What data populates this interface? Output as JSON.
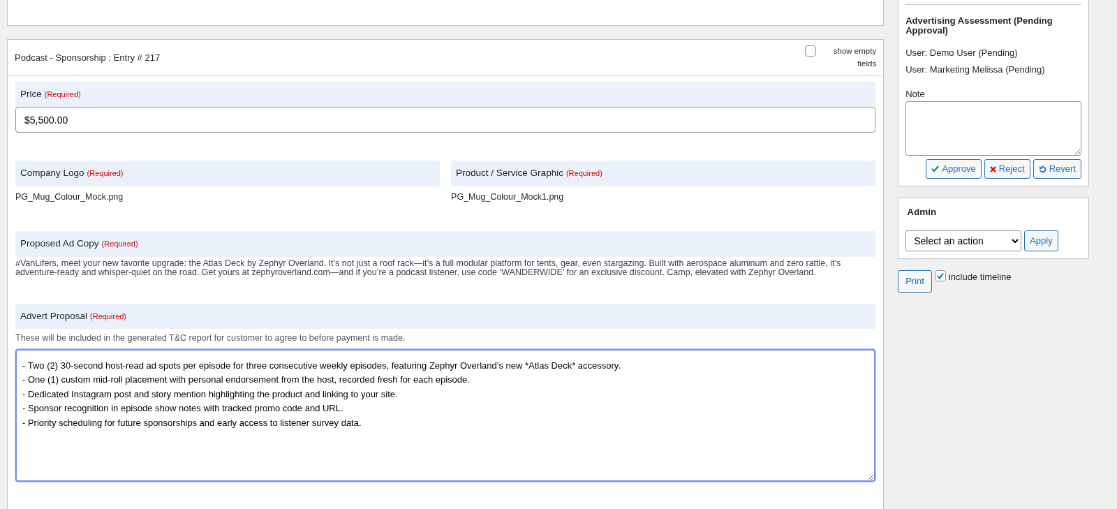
{
  "entry": {
    "title": "Podcast - Sponsorship : Entry # 217",
    "show_empty": {
      "label": "show empty fields",
      "checked": false
    },
    "fields": [
      {
        "kind": "input",
        "label": "Price",
        "required": "(Required)",
        "value": "$5,500.00"
      },
      {
        "kind": "files",
        "items": [
          {
            "label": "Company Logo",
            "required": "(Required)",
            "value": "PG_Mug_Colour_Mock.png"
          },
          {
            "label": "Product / Service Graphic",
            "required": "(Required)",
            "value": "PG_Mug_Colour_Mock1.png"
          }
        ]
      },
      {
        "kind": "paragraph",
        "label": "Proposed Ad Copy",
        "required": "(Required)",
        "value": "#VanLifers, meet your new favorite upgrade: the Atlas Deck by Zephyr Overland. It’s not just a roof rack—it’s a full modular platform for tents, gear, even stargazing. Built with aerospace aluminum and zero rattle, it’s adventure-ready and whisper-quiet on the road. Get yours at zephyroverland.com—and if you’re a podcast listener, use code ‘WANDERWIDE’ for an exclusive discount. Camp, elevated with Zephyr Overland."
      },
      {
        "kind": "textarea",
        "label": "Advert Proposal",
        "required": "(Required)",
        "description": "These will be included in the generated T&C report for customer to agree to before payment is made.",
        "value": "- Two (2) 30-second host-read ad spots per episode for three consecutive weekly episodes, featuring Zephyr Overland’s new *Atlas Deck* accessory.\n- One (1) custom mid-roll placement with personal endorsement from the host, recorded fresh for each episode.\n- Dedicated Instagram post and story mention highlighting the product and linking to your site.\n- Sponsor recognition in episode show notes with tracked promo code and URL.\n- Priority scheduling for future sponsorships and early access to listener survey data."
      }
    ]
  },
  "assessment": {
    "title": "Advertising Assessment (Pending Approval)",
    "users": [
      "User: Demo User (Pending)",
      "User: Marketing Melissa (Pending)"
    ],
    "note_label": "Note",
    "buttons": [
      {
        "kind": "approve",
        "label": "Approve"
      },
      {
        "kind": "reject",
        "label": "Reject"
      },
      {
        "kind": "revert",
        "label": "Revert"
      }
    ]
  },
  "admin": {
    "title": "Admin",
    "select": "Select an action",
    "apply": "Apply"
  },
  "print": {
    "label": "Print",
    "timeline": {
      "label": "include timeline",
      "checked": true
    }
  }
}
